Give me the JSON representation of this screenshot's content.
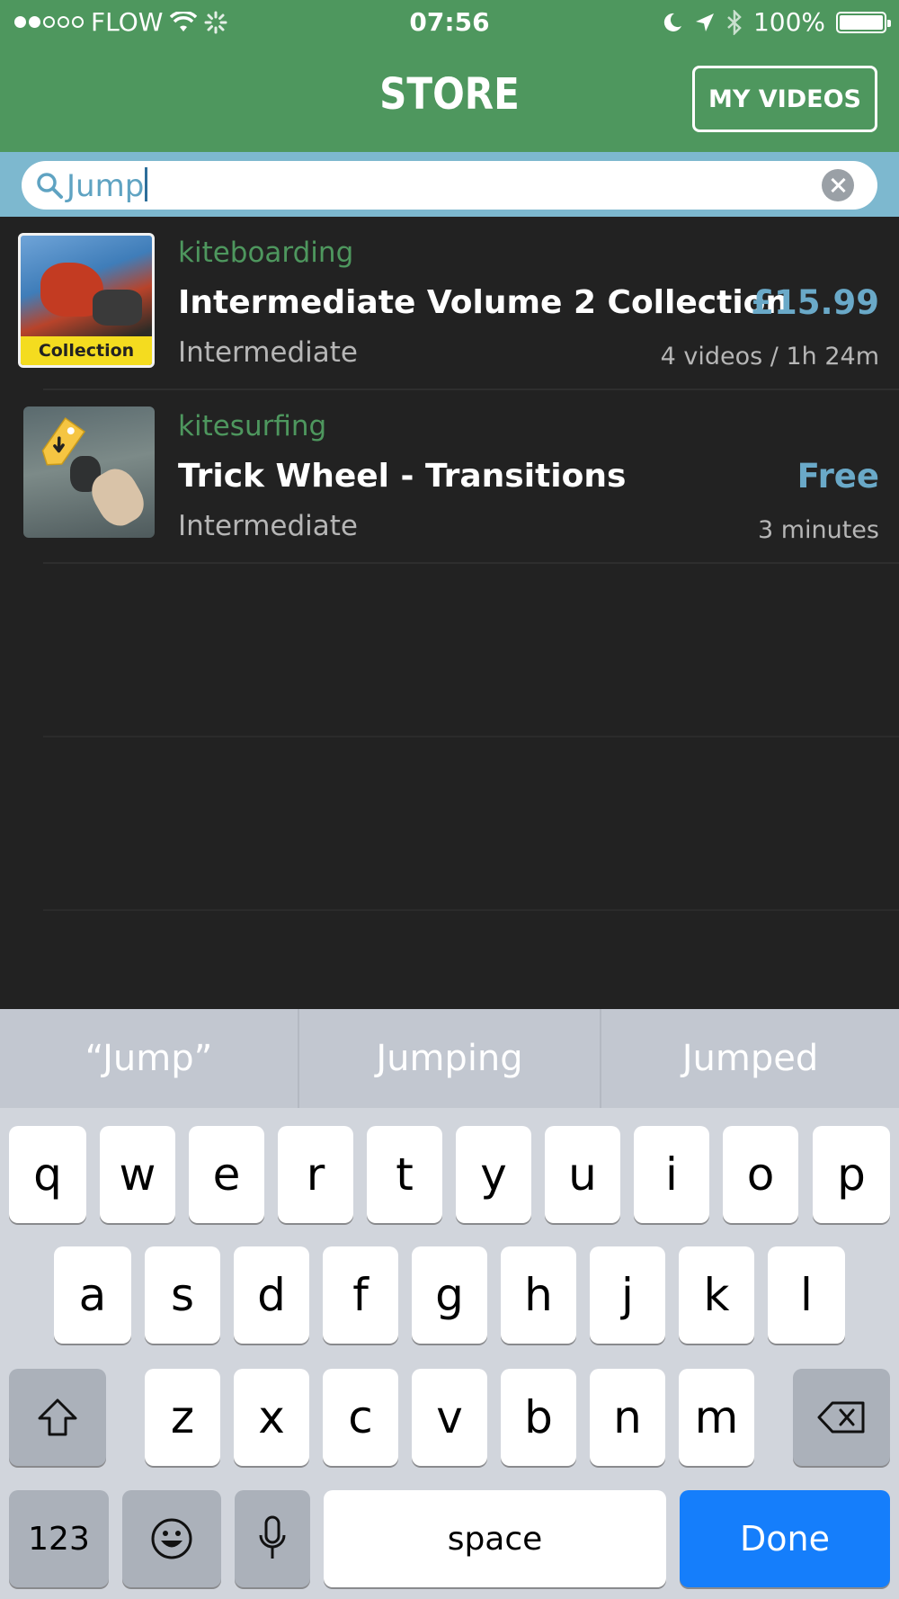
{
  "status_bar": {
    "carrier": "FLOW",
    "time": "07:56",
    "battery": "100%",
    "signal_dots_filled": 2,
    "signal_dots_total": 5
  },
  "nav": {
    "title": "STORE",
    "my_videos_label": "MY VIDEOS"
  },
  "search": {
    "value": "Jump"
  },
  "results": [
    {
      "category": "kiteboarding",
      "title": "Intermediate Volume 2 Collection",
      "level": "Intermediate",
      "price": "£15.99",
      "meta": "4 videos / 1h 24m",
      "badge": "Collection"
    },
    {
      "category": "kitesurfing",
      "title": "Trick Wheel - Transitions",
      "level": "Intermediate",
      "price": "Free",
      "meta": "3 minutes"
    }
  ],
  "keyboard": {
    "suggestions": [
      "“Jump”",
      "Jumping",
      "Jumped"
    ],
    "row1": [
      "q",
      "w",
      "e",
      "r",
      "t",
      "y",
      "u",
      "i",
      "o",
      "p"
    ],
    "row2": [
      "a",
      "s",
      "d",
      "f",
      "g",
      "h",
      "j",
      "k",
      "l"
    ],
    "row3": [
      "z",
      "x",
      "c",
      "v",
      "b",
      "n",
      "m"
    ],
    "numbers_label": "123",
    "space_label": "space",
    "done_label": "Done"
  },
  "colors": {
    "nav_green": "#4e975e",
    "search_bar_blue": "#7db8cf",
    "price_blue": "#6aa9c8",
    "done_blue": "#157efb"
  }
}
